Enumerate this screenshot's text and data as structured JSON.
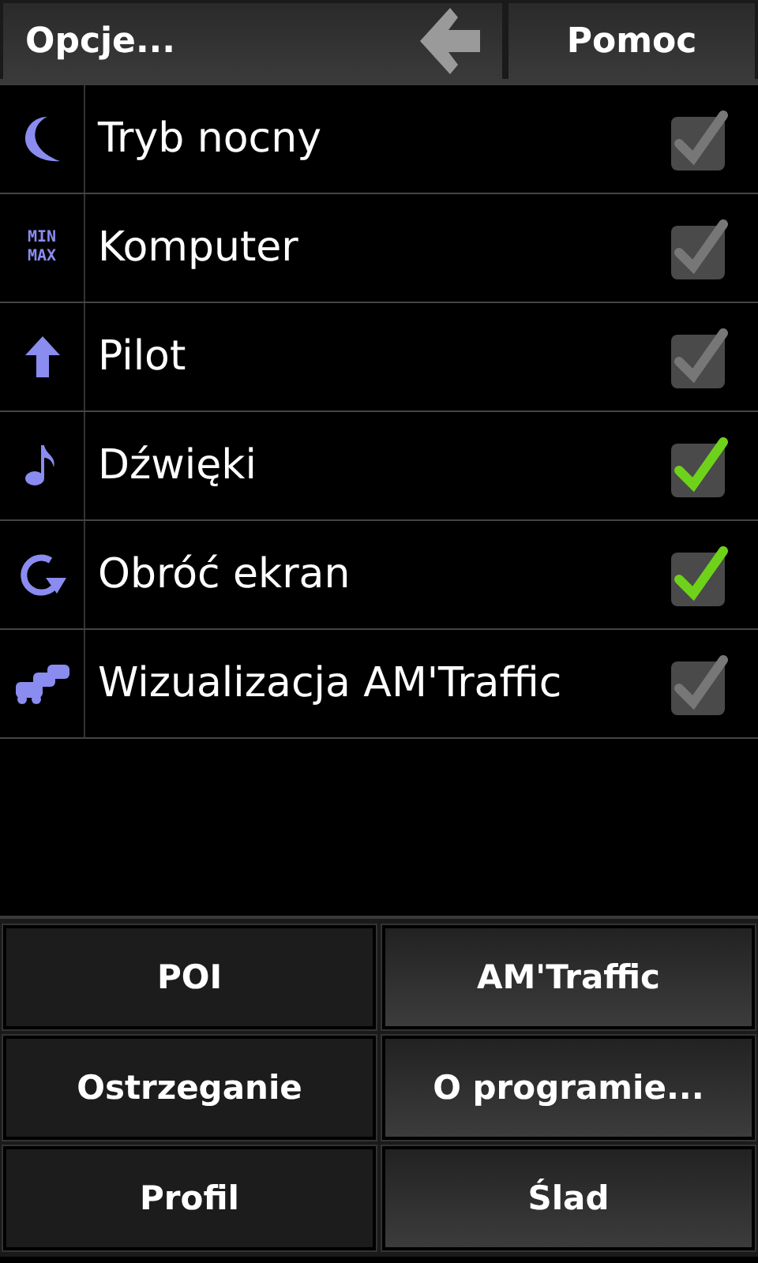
{
  "header": {
    "title": "Opcje...",
    "help": "Pomoc"
  },
  "options": [
    {
      "label": "Tryb nocny",
      "checked": true,
      "disabled": true
    },
    {
      "icon_text": [
        "MIN",
        "MAX"
      ],
      "label": "Komputer",
      "checked": true,
      "disabled": true
    },
    {
      "label": "Pilot",
      "checked": true,
      "disabled": true
    },
    {
      "label": "Dźwięki",
      "checked": true,
      "disabled": false
    },
    {
      "label": "Obróć ekran",
      "checked": true,
      "disabled": false
    },
    {
      "label": "Wizualizacja AM'Traffic",
      "checked": true,
      "disabled": true
    }
  ],
  "buttons": [
    {
      "label": "POI",
      "kind": "flat"
    },
    {
      "label": "AM'Traffic",
      "kind": "raised"
    },
    {
      "label": "Ostrzeganie",
      "kind": "flat"
    },
    {
      "label": "O programie...",
      "kind": "raised"
    },
    {
      "label": "Profil",
      "kind": "flat"
    },
    {
      "label": "Ślad",
      "kind": "raised"
    }
  ]
}
